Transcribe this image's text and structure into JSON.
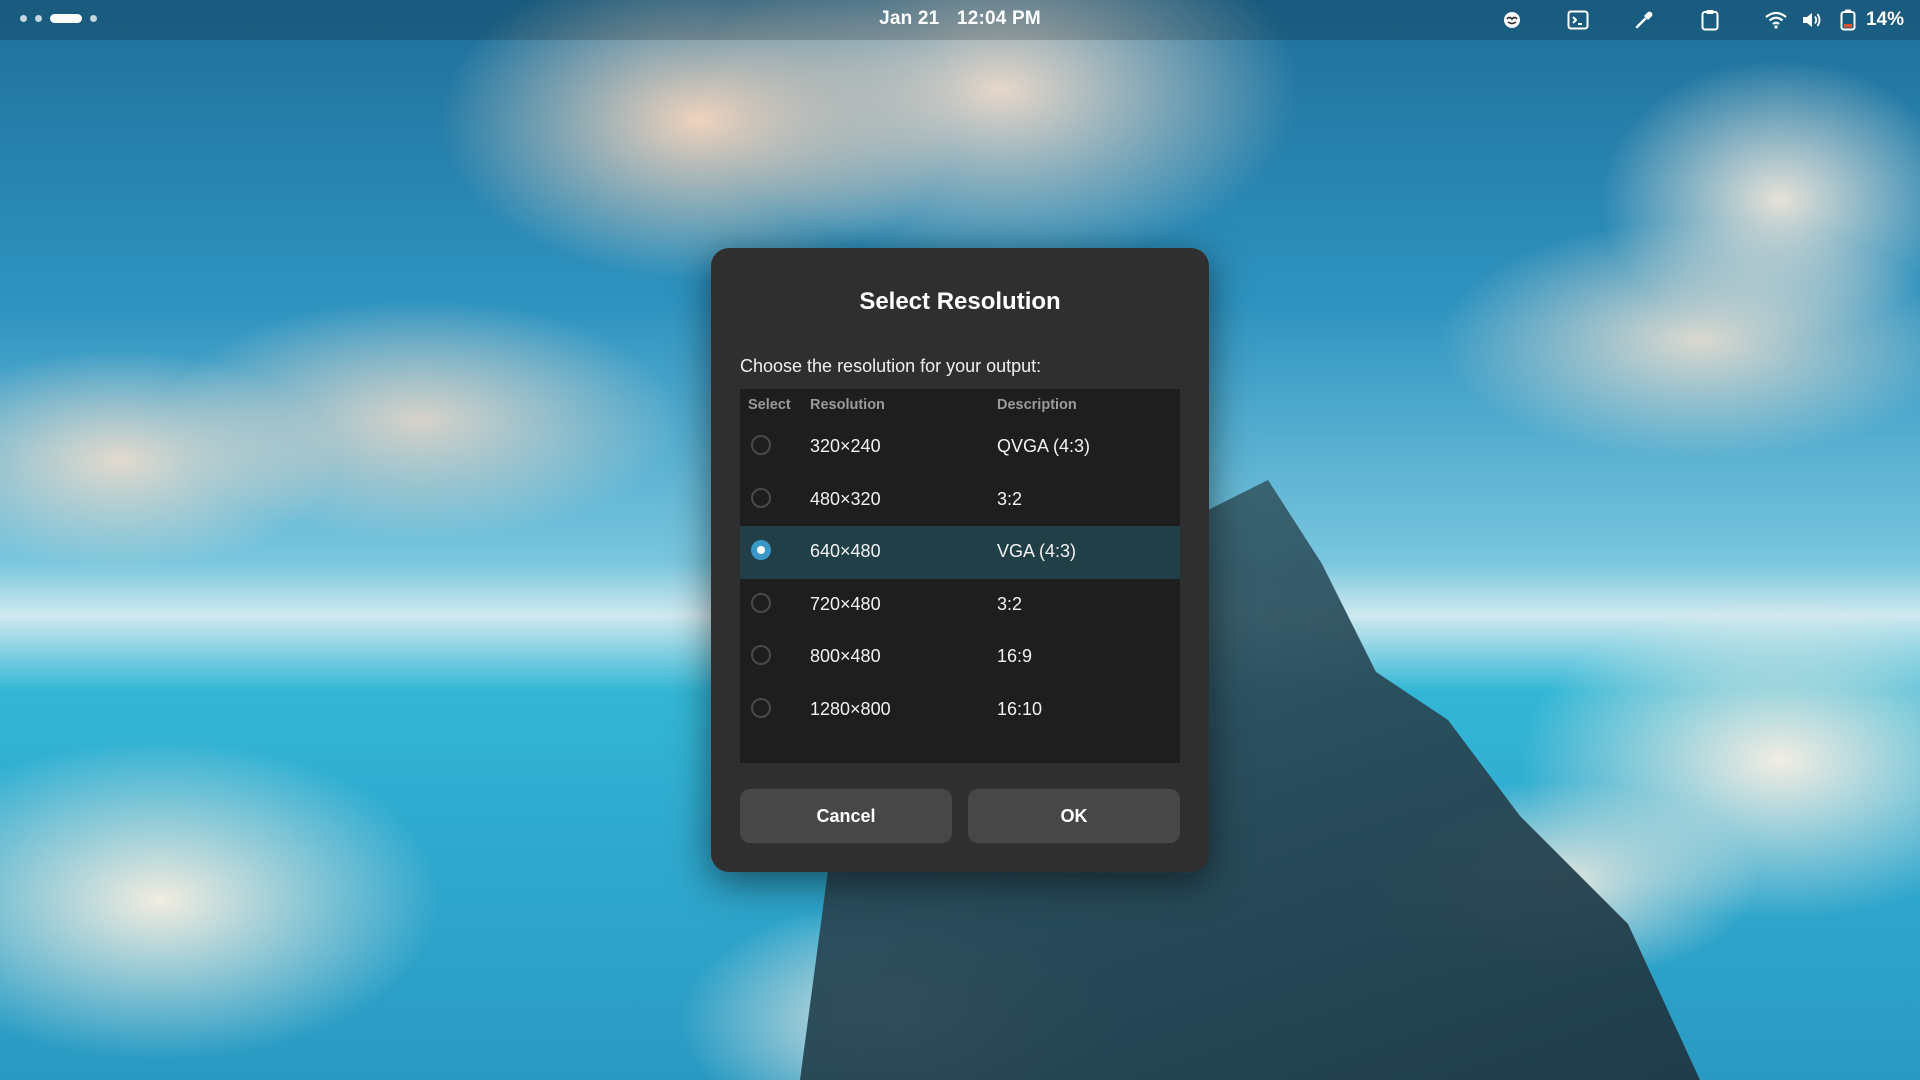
{
  "topbar": {
    "date": "Jan 21",
    "time": "12:04 PM",
    "battery_percent": "14%",
    "tray_icons": [
      "caffeine-icon",
      "terminal-icon",
      "color-picker-icon",
      "clipboard-icon",
      "wifi-icon",
      "volume-icon",
      "battery-icon"
    ]
  },
  "dialog": {
    "title": "Select Resolution",
    "subtitle": "Choose the resolution for your output:",
    "columns": [
      "Select",
      "Resolution",
      "Description"
    ],
    "rows": [
      {
        "resolution": "320×240",
        "description": "QVGA (4:3)",
        "selected": false
      },
      {
        "resolution": "480×320",
        "description": "3:2",
        "selected": false
      },
      {
        "resolution": "640×480",
        "description": "VGA (4:3)",
        "selected": true
      },
      {
        "resolution": "720×480",
        "description": "3:2",
        "selected": false
      },
      {
        "resolution": "800×480",
        "description": "16:9",
        "selected": false
      },
      {
        "resolution": "1280×800",
        "description": "16:10",
        "selected": false
      }
    ],
    "cancel_label": "Cancel",
    "ok_label": "OK"
  },
  "colors": {
    "dialog_bg": "#2f2f2f",
    "table_bg": "#1e1e1e",
    "selected_row": "#213f47",
    "accent": "#3a98c9",
    "button_bg": "#474747"
  }
}
